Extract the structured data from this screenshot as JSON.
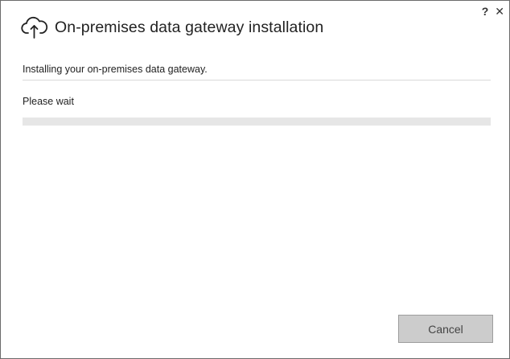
{
  "window": {
    "help_label": "?",
    "close_label": "✕"
  },
  "header": {
    "icon": "cloud-upload-icon",
    "title": "On-premises data gateway installation"
  },
  "main": {
    "status": "Installing your on-premises data gateway.",
    "wait_label": "Please wait",
    "progress_fraction": 0
  },
  "footer": {
    "cancel_label": "Cancel"
  },
  "colors": {
    "progress_track": "#e6e6e6",
    "button_bg": "#cccccc",
    "border": "#6b6b6b"
  }
}
